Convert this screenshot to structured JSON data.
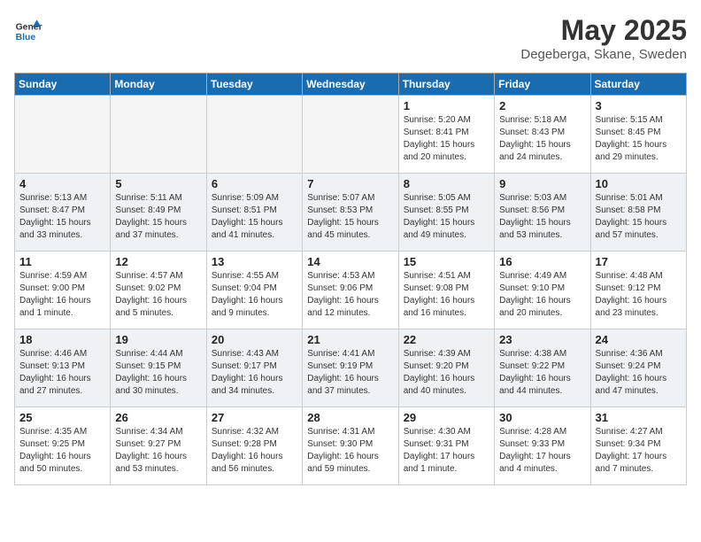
{
  "header": {
    "logo_line1": "General",
    "logo_line2": "Blue",
    "month": "May 2025",
    "location": "Degeberga, Skane, Sweden"
  },
  "days_of_week": [
    "Sunday",
    "Monday",
    "Tuesday",
    "Wednesday",
    "Thursday",
    "Friday",
    "Saturday"
  ],
  "weeks": [
    [
      {
        "num": "",
        "content": ""
      },
      {
        "num": "",
        "content": ""
      },
      {
        "num": "",
        "content": ""
      },
      {
        "num": "",
        "content": ""
      },
      {
        "num": "1",
        "content": "Sunrise: 5:20 AM\nSunset: 8:41 PM\nDaylight: 15 hours\nand 20 minutes."
      },
      {
        "num": "2",
        "content": "Sunrise: 5:18 AM\nSunset: 8:43 PM\nDaylight: 15 hours\nand 24 minutes."
      },
      {
        "num": "3",
        "content": "Sunrise: 5:15 AM\nSunset: 8:45 PM\nDaylight: 15 hours\nand 29 minutes."
      }
    ],
    [
      {
        "num": "4",
        "content": "Sunrise: 5:13 AM\nSunset: 8:47 PM\nDaylight: 15 hours\nand 33 minutes."
      },
      {
        "num": "5",
        "content": "Sunrise: 5:11 AM\nSunset: 8:49 PM\nDaylight: 15 hours\nand 37 minutes."
      },
      {
        "num": "6",
        "content": "Sunrise: 5:09 AM\nSunset: 8:51 PM\nDaylight: 15 hours\nand 41 minutes."
      },
      {
        "num": "7",
        "content": "Sunrise: 5:07 AM\nSunset: 8:53 PM\nDaylight: 15 hours\nand 45 minutes."
      },
      {
        "num": "8",
        "content": "Sunrise: 5:05 AM\nSunset: 8:55 PM\nDaylight: 15 hours\nand 49 minutes."
      },
      {
        "num": "9",
        "content": "Sunrise: 5:03 AM\nSunset: 8:56 PM\nDaylight: 15 hours\nand 53 minutes."
      },
      {
        "num": "10",
        "content": "Sunrise: 5:01 AM\nSunset: 8:58 PM\nDaylight: 15 hours\nand 57 minutes."
      }
    ],
    [
      {
        "num": "11",
        "content": "Sunrise: 4:59 AM\nSunset: 9:00 PM\nDaylight: 16 hours\nand 1 minute."
      },
      {
        "num": "12",
        "content": "Sunrise: 4:57 AM\nSunset: 9:02 PM\nDaylight: 16 hours\nand 5 minutes."
      },
      {
        "num": "13",
        "content": "Sunrise: 4:55 AM\nSunset: 9:04 PM\nDaylight: 16 hours\nand 9 minutes."
      },
      {
        "num": "14",
        "content": "Sunrise: 4:53 AM\nSunset: 9:06 PM\nDaylight: 16 hours\nand 12 minutes."
      },
      {
        "num": "15",
        "content": "Sunrise: 4:51 AM\nSunset: 9:08 PM\nDaylight: 16 hours\nand 16 minutes."
      },
      {
        "num": "16",
        "content": "Sunrise: 4:49 AM\nSunset: 9:10 PM\nDaylight: 16 hours\nand 20 minutes."
      },
      {
        "num": "17",
        "content": "Sunrise: 4:48 AM\nSunset: 9:12 PM\nDaylight: 16 hours\nand 23 minutes."
      }
    ],
    [
      {
        "num": "18",
        "content": "Sunrise: 4:46 AM\nSunset: 9:13 PM\nDaylight: 16 hours\nand 27 minutes."
      },
      {
        "num": "19",
        "content": "Sunrise: 4:44 AM\nSunset: 9:15 PM\nDaylight: 16 hours\nand 30 minutes."
      },
      {
        "num": "20",
        "content": "Sunrise: 4:43 AM\nSunset: 9:17 PM\nDaylight: 16 hours\nand 34 minutes."
      },
      {
        "num": "21",
        "content": "Sunrise: 4:41 AM\nSunset: 9:19 PM\nDaylight: 16 hours\nand 37 minutes."
      },
      {
        "num": "22",
        "content": "Sunrise: 4:39 AM\nSunset: 9:20 PM\nDaylight: 16 hours\nand 40 minutes."
      },
      {
        "num": "23",
        "content": "Sunrise: 4:38 AM\nSunset: 9:22 PM\nDaylight: 16 hours\nand 44 minutes."
      },
      {
        "num": "24",
        "content": "Sunrise: 4:36 AM\nSunset: 9:24 PM\nDaylight: 16 hours\nand 47 minutes."
      }
    ],
    [
      {
        "num": "25",
        "content": "Sunrise: 4:35 AM\nSunset: 9:25 PM\nDaylight: 16 hours\nand 50 minutes."
      },
      {
        "num": "26",
        "content": "Sunrise: 4:34 AM\nSunset: 9:27 PM\nDaylight: 16 hours\nand 53 minutes."
      },
      {
        "num": "27",
        "content": "Sunrise: 4:32 AM\nSunset: 9:28 PM\nDaylight: 16 hours\nand 56 minutes."
      },
      {
        "num": "28",
        "content": "Sunrise: 4:31 AM\nSunset: 9:30 PM\nDaylight: 16 hours\nand 59 minutes."
      },
      {
        "num": "29",
        "content": "Sunrise: 4:30 AM\nSunset: 9:31 PM\nDaylight: 17 hours\nand 1 minute."
      },
      {
        "num": "30",
        "content": "Sunrise: 4:28 AM\nSunset: 9:33 PM\nDaylight: 17 hours\nand 4 minutes."
      },
      {
        "num": "31",
        "content": "Sunrise: 4:27 AM\nSunset: 9:34 PM\nDaylight: 17 hours\nand 7 minutes."
      }
    ]
  ]
}
